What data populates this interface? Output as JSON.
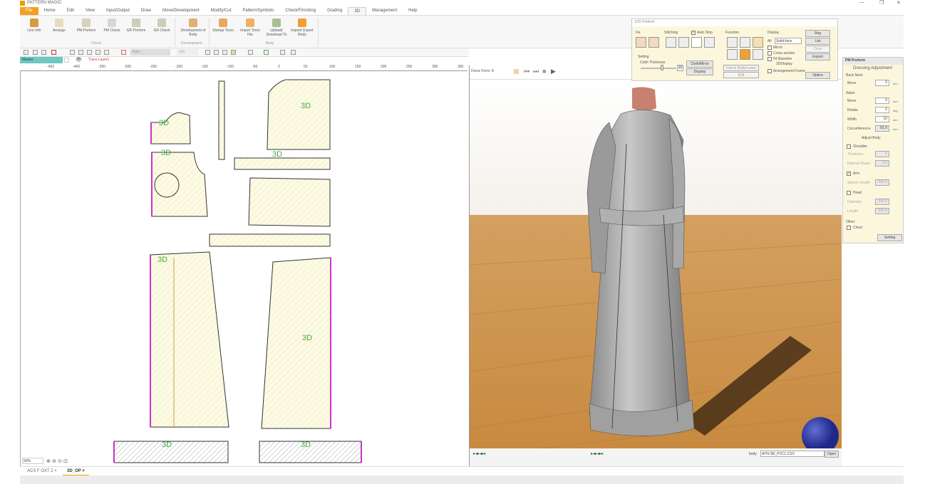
{
  "app": {
    "title": "PATTERN MAGIC",
    "window_controls": [
      "—",
      "❐",
      "✕"
    ]
  },
  "menu": [
    "File",
    "Home",
    "Edit",
    "View",
    "Input/Output",
    "Draw",
    "Move/Development",
    "Modify/Cut",
    "Pattern/Symbols",
    "Check/Finishing",
    "Grading",
    "3D",
    "Management",
    "Help"
  ],
  "menu_active": "3D",
  "ribbon": {
    "buttons": [
      "Line Info",
      "Arrange",
      "PM Preform",
      "PM Check",
      "GR Preform",
      "GR Check",
      "Development of Body",
      "Startup Torso",
      "Import Torso File",
      "Upload/ Download To",
      "Import/ Export Body"
    ],
    "groups": [
      "Check",
      "Development",
      "Body"
    ]
  },
  "toolbar": {
    "auto_value": "Auto",
    "size_value": "100"
  },
  "layer": {
    "select": "Master",
    "trace_layer": "Trace Layer1"
  },
  "ruler": [
    "-450",
    "-400",
    "-350",
    "-300",
    "-250",
    "-200",
    "-150",
    "-100",
    "-50",
    "0",
    "50",
    "100",
    "150",
    "200",
    "250",
    "300",
    "350"
  ],
  "pattern": {
    "label_3d": "3D",
    "piece_color": "#fdfbe3",
    "accent": "#cc33cc",
    "zoom": "50%"
  },
  "view3d": {
    "dummy_select": "Dress Form: A",
    "key_symbols": "▸◂▸◂▸▸",
    "body_label": "body",
    "body_value": "AYN-SR_PVCL.CSV",
    "open_btn": "Open"
  },
  "icr": {
    "title": "ICR Preform",
    "fix": "Fix",
    "stitching": "Stitching",
    "auto_stop": "Auto Stop",
    "function": "Function",
    "display": "Display",
    "all": "All",
    "display_select": "Solid-face",
    "mirror": "Mirror",
    "cross_section": "Cross section",
    "fit_baseline": "Fit Baseline",
    "display_3d": "3DDisplay",
    "arrangement_frame": "Arrangement Frame",
    "setting": "Setting",
    "cloth_thickness": "Cloth Thickness",
    "thickness_value": "10",
    "cloth_mirror": "Cloth/Mirror",
    "display_btn": "Display",
    "check_body": "Check Body/Lower",
    "edit": "Edit",
    "reg": "Reg",
    "list": "List",
    "clear": "Clear",
    "export": "Export",
    "option": "Option"
  },
  "rpanel": {
    "title": "PM Preform",
    "dressing": "Dressing Adjustment",
    "back_neck": "Back Neck",
    "move": "Move",
    "waist": "Waist",
    "rotate": "Rotate",
    "width": "Width",
    "circumference": "Circumference",
    "back_move_val": "0",
    "waist_move_val": "0",
    "rotate_val": "0",
    "width_val": "10",
    "circ_val": "81.9",
    "unit_mm": "mm",
    "unit_deg": "deg",
    "adjust_body": "Adjust Body",
    "shoulder": "Shoulder",
    "thickness": "Thickness",
    "thick_val": "0",
    "internal": "Internal Shape",
    "internal_val": "0.0",
    "arm": "Arm",
    "sleeve_length": "Sleeve Length",
    "sleeve_val": "550.0",
    "head": "Head",
    "diameter": "Diameter",
    "diameter_val": "540.0",
    "length": "Length",
    "length_val": "560.0",
    "other": "Other",
    "chest": "Chest",
    "setting_btn": "Setting"
  },
  "doc_tabs": [
    {
      "label": "ACS F OXT 2",
      "active": false
    },
    {
      "label": "3D_OP",
      "active": true
    }
  ],
  "close_glyph": "×"
}
